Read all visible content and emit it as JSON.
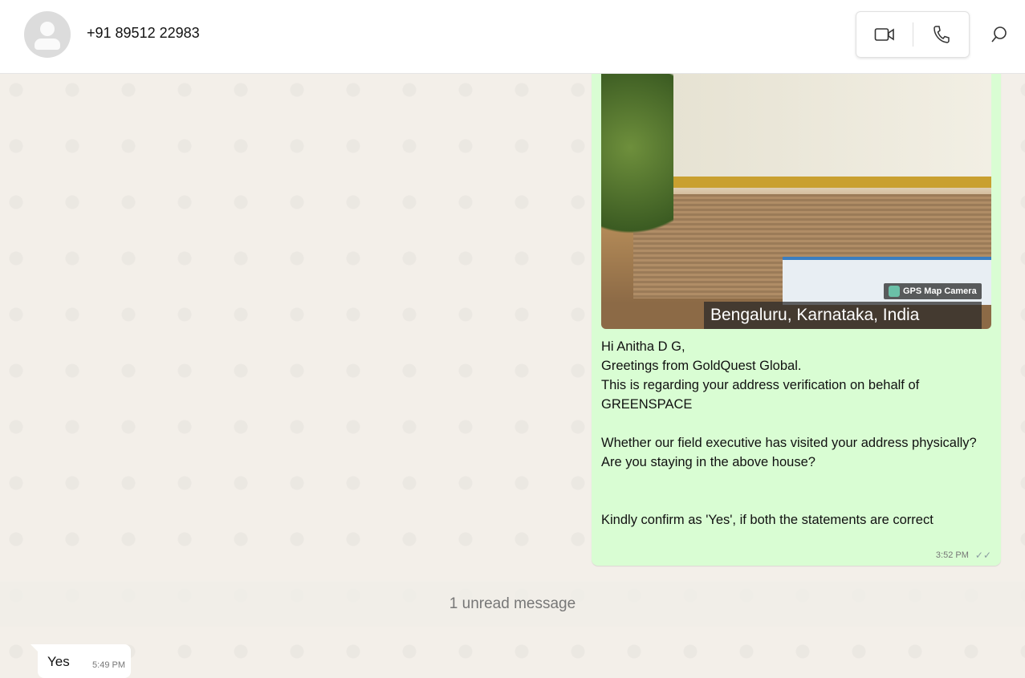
{
  "header": {
    "contact": "+91 89512 22983",
    "video_icon": "video-icon",
    "call_icon": "phone-icon",
    "search_icon": "search-icon"
  },
  "messages": {
    "outgoing": {
      "image": {
        "location": "Bengaluru, Karnataka, India",
        "watermark": "GPS Map Camera"
      },
      "text": "Hi Anitha D G,\nGreetings from GoldQuest Global.\nThis is regarding your address verification on behalf of GREENSPACE\n\nWhether our field executive has visited your address physically?\nAre you staying in the above house?\n\n\nKindly confirm as 'Yes', if both the statements are correct",
      "time": "3:52 PM",
      "status": "✓✓"
    },
    "unread_banner": "1 unread message",
    "incoming": {
      "text": "Yes",
      "time": "5:49 PM"
    }
  }
}
